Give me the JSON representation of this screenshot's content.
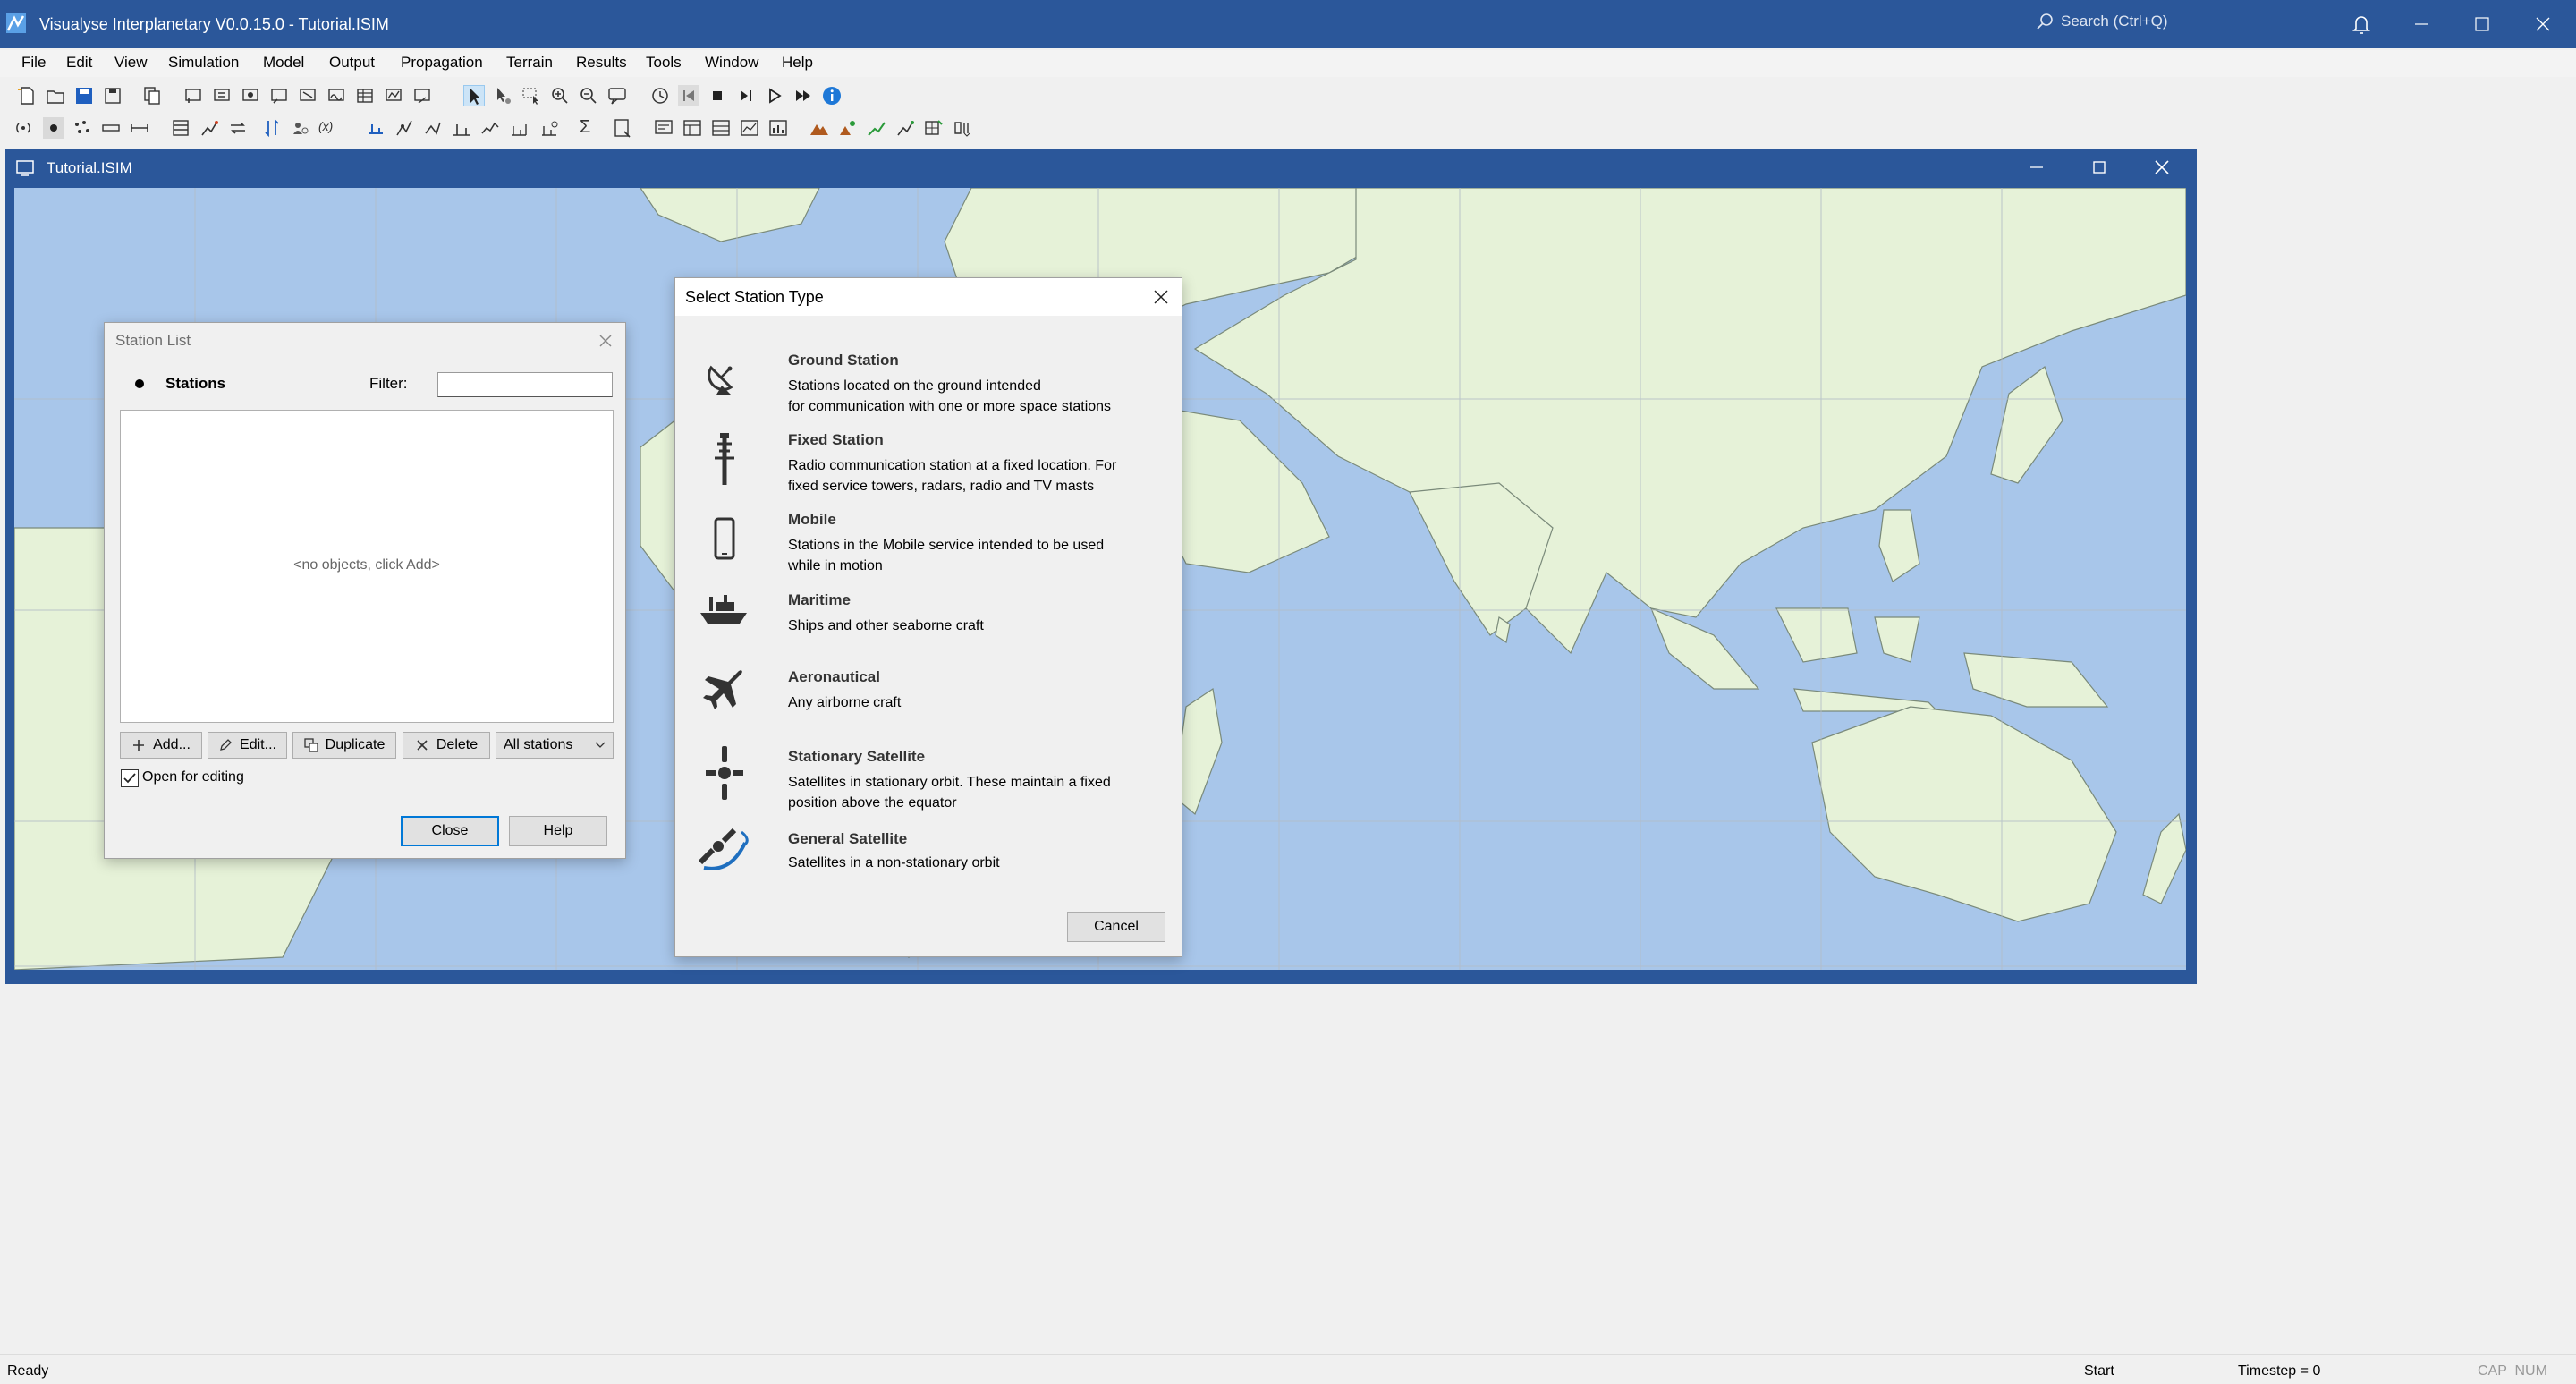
{
  "app": {
    "title": "Visualyse Interplanetary V0.0.15.0 - Tutorial.ISIM",
    "search_placeholder": "Search (Ctrl+Q)",
    "accent": "#2b579a"
  },
  "menu": [
    "File",
    "Edit",
    "View",
    "Simulation",
    "Model",
    "Output",
    "Propagation",
    "Terrain",
    "Results",
    "Tools",
    "Window",
    "Help"
  ],
  "document": {
    "title": "Tutorial.ISIM",
    "map_ocean_color": "#a8c6ea",
    "map_land_color": "#e6f2d8"
  },
  "station_list": {
    "title": "Station List",
    "stations_label": "Stations",
    "filter_label": "Filter:",
    "filter_value": "",
    "empty_text": "<no objects, click Add>",
    "buttons": {
      "add": "Add...",
      "edit": "Edit...",
      "duplicate": "Duplicate",
      "delete": "Delete"
    },
    "scope_select": "All stations",
    "open_for_editing": "Open for editing",
    "open_for_editing_checked": true,
    "close": "Close",
    "help": "Help"
  },
  "station_type": {
    "title": "Select Station Type",
    "options": [
      {
        "name": "Ground Station",
        "desc1": "Stations located on the ground intended",
        "desc2": "for communication with one or more space stations",
        "icon": "satellite-dish-icon"
      },
      {
        "name": "Fixed Station",
        "desc1": "Radio communication station at a fixed location. For",
        "desc2": "fixed service towers, radars, radio and TV masts",
        "icon": "radio-tower-icon"
      },
      {
        "name": "Mobile",
        "desc1": "Stations in the Mobile service intended to be used",
        "desc2": "while in motion",
        "icon": "mobile-phone-icon"
      },
      {
        "name": "Maritime",
        "desc1": "Ships and other seaborne craft",
        "desc2": "",
        "icon": "ship-icon"
      },
      {
        "name": "Aeronautical",
        "desc1": "Any airborne craft",
        "desc2": "",
        "icon": "airplane-icon"
      },
      {
        "name": "Stationary Satellite",
        "desc1": "Satellites in stationary orbit. These maintain a fixed",
        "desc2": "position above the equator",
        "icon": "stationary-satellite-icon"
      },
      {
        "name": "General Satellite",
        "desc1": "Satellites in a non-stationary orbit",
        "desc2": "",
        "icon": "orbiting-satellite-icon"
      }
    ],
    "cancel": "Cancel"
  },
  "status": {
    "ready": "Ready",
    "mode": "Start",
    "timestep": "Timestep = 0",
    "keys": "CAP  NUM"
  }
}
